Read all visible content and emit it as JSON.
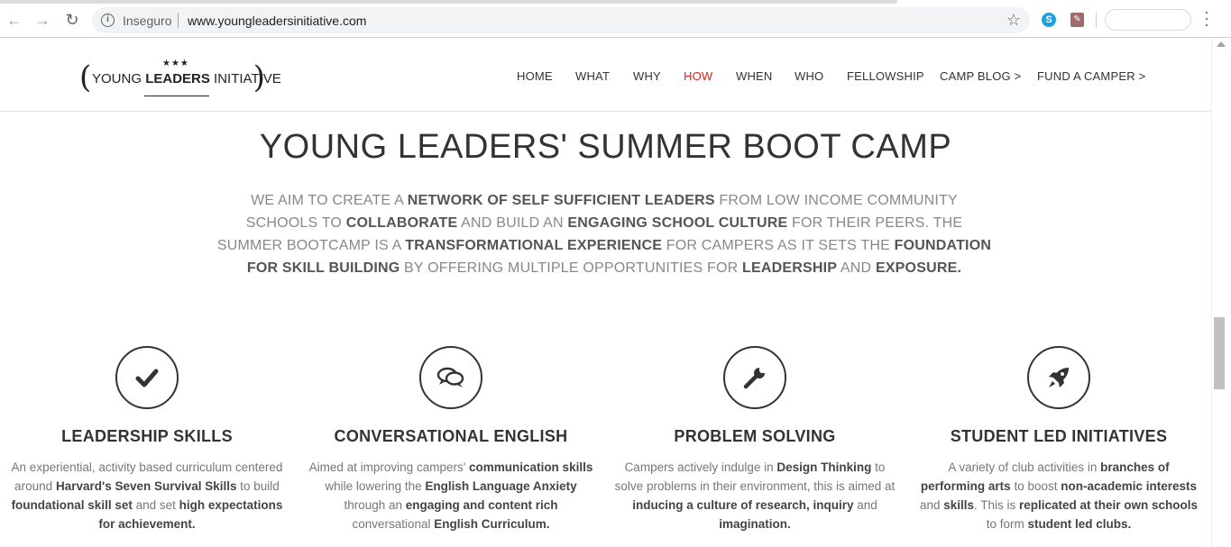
{
  "browser": {
    "security_label": "Inseguro",
    "url": "www.youngleadersinitiative.com"
  },
  "logo": {
    "text_young": "YOUNG ",
    "text_leaders": "LEADERS",
    "text_initiative": " INITIATIVE",
    "stars": "★★★"
  },
  "nav": {
    "items": [
      {
        "label": "HOME"
      },
      {
        "label": "WHAT"
      },
      {
        "label": "WHY"
      },
      {
        "label": "HOW"
      },
      {
        "label": "WHEN"
      },
      {
        "label": "WHO"
      },
      {
        "label": "FELLOWSHIP"
      },
      {
        "label": "CAMP BLOG >"
      },
      {
        "label": "FUND A CAMPER >"
      }
    ],
    "active": "HOW"
  },
  "main": {
    "title": "YOUNG LEADERS' SUMMER BOOT CAMP",
    "intro": [
      {
        "t": "WE AIM TO CREATE A ",
        "b": false
      },
      {
        "t": "NETWORK OF SELF SUFFICIENT LEADERS",
        "b": true
      },
      {
        "t": " FROM LOW INCOME COMMUNITY SCHOOLS TO ",
        "b": false
      },
      {
        "t": "COLLABORATE",
        "b": true
      },
      {
        "t": " AND BUILD AN ",
        "b": false
      },
      {
        "t": "ENGAGING SCHOOL CULTURE",
        "b": true
      },
      {
        "t": " FOR THEIR PEERS. THE SUMMER BOOTCAMP IS A ",
        "b": false
      },
      {
        "t": "TRANSFORMATIONAL EXPERIENCE",
        "b": true
      },
      {
        "t": " FOR CAMPERS AS IT SETS THE ",
        "b": false
      },
      {
        "t": "FOUNDATION FOR SKILL BUILDING",
        "b": true
      },
      {
        "t": " BY OFFERING MULTIPLE OPPORTUNITIES FOR ",
        "b": false
      },
      {
        "t": "LEADERSHIP",
        "b": true
      },
      {
        "t": " AND ",
        "b": false
      },
      {
        "t": "EXPOSURE.",
        "b": true
      }
    ]
  },
  "features": [
    {
      "icon": "checkmark-icon",
      "title": "LEADERSHIP SKILLS",
      "desc": [
        {
          "t": "An experiential, activity based curriculum centered around ",
          "b": false
        },
        {
          "t": "Harvard's Seven Survival Skills",
          "b": true
        },
        {
          "t": " to build ",
          "b": false
        },
        {
          "t": "foundational skill set",
          "b": true
        },
        {
          "t": " and set ",
          "b": false
        },
        {
          "t": "high expectations for achievement.",
          "b": true
        }
      ]
    },
    {
      "icon": "chat-bubbles-icon",
      "title": "CONVERSATIONAL ENGLISH",
      "desc": [
        {
          "t": "Aimed at improving campers' ",
          "b": false
        },
        {
          "t": "communication skills",
          "b": true
        },
        {
          "t": " while lowering the ",
          "b": false
        },
        {
          "t": "English Language Anxiety",
          "b": true
        },
        {
          "t": " through an ",
          "b": false
        },
        {
          "t": "engaging and content rich",
          "b": true
        },
        {
          "t": " conversational ",
          "b": false
        },
        {
          "t": "English Curriculum.",
          "b": true
        }
      ]
    },
    {
      "icon": "wrench-icon",
      "title": "PROBLEM SOLVING",
      "desc": [
        {
          "t": "Campers actively indulge in ",
          "b": false
        },
        {
          "t": "Design Thinking",
          "b": true
        },
        {
          "t": " to solve problems in their environment, this is aimed at ",
          "b": false
        },
        {
          "t": "inducing a culture of research, inquiry",
          "b": true
        },
        {
          "t": " and ",
          "b": false
        },
        {
          "t": "imagination.",
          "b": true
        }
      ]
    },
    {
      "icon": "rocket-icon",
      "title": "STUDENT LED INITIATIVES",
      "desc": [
        {
          "t": "A variety of club activities in ",
          "b": false
        },
        {
          "t": "branches of performing arts",
          "b": true
        },
        {
          "t": " to boost ",
          "b": false
        },
        {
          "t": "non-academic interests",
          "b": true
        },
        {
          "t": " and ",
          "b": false
        },
        {
          "t": "skills",
          "b": true
        },
        {
          "t": ". This is ",
          "b": false
        },
        {
          "t": "replicated at their own schools",
          "b": true
        },
        {
          "t": " to form ",
          "b": false
        },
        {
          "t": "student led clubs.",
          "b": true
        }
      ]
    }
  ],
  "colors": {
    "accent": "#d8261c",
    "text_dark": "#333333",
    "text_muted": "#888888"
  }
}
